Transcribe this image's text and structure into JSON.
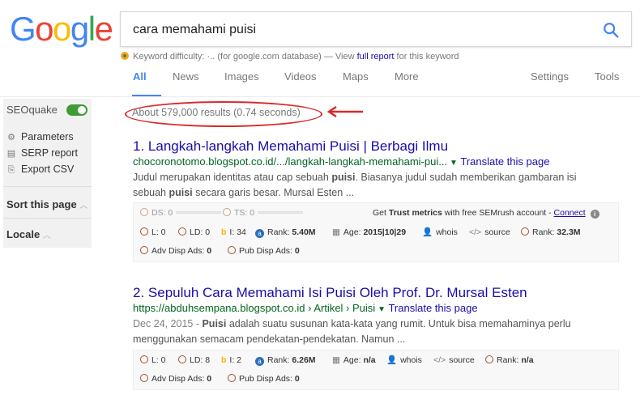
{
  "logo": {
    "letters": [
      "G",
      "o",
      "o",
      "g",
      "l",
      "e"
    ],
    "colors": [
      "#4285f4",
      "#ea4335",
      "#fbbc05",
      "#4285f4",
      "#34a853",
      "#ea4335"
    ]
  },
  "search": {
    "query": "cara memahami puisi",
    "icon": "search-icon"
  },
  "keyword_difficulty": {
    "label": "Keyword difficulty:",
    "value": "·..",
    "source": "(for google.com database) — View",
    "link": "full report",
    "suffix": "for this keyword"
  },
  "tabs": [
    {
      "label": "All",
      "active": true
    },
    {
      "label": "News"
    },
    {
      "label": "Images"
    },
    {
      "label": "Videos"
    },
    {
      "label": "Maps"
    },
    {
      "label": "More"
    },
    {
      "label": "Settings"
    },
    {
      "label": "Tools"
    }
  ],
  "sidebar": {
    "title": "SEOquake",
    "toggle_on": true,
    "items": [
      {
        "label": "Parameters",
        "icon": "gear-icon"
      },
      {
        "label": "SERP report",
        "icon": "report-icon"
      },
      {
        "label": "Export CSV",
        "icon": "export-icon"
      }
    ],
    "sort_label": "Sort this page",
    "locale_label": "Locale"
  },
  "stats": "About 579,000 results (0.74 seconds)",
  "results": [
    {
      "number": "1.",
      "title": "Langkah-langkah Memahami Puisi | Berbagi Ilmu",
      "url": "chocoronotomo.blogspot.co.id/.../langkah-langkah-memahami-pui...",
      "translate": "Translate this page",
      "snippet_line1": [
        {
          "t": "Judul merupakan identitas atau cap sebuah "
        },
        {
          "t": "puisi",
          "b": true
        },
        {
          "t": ". Biasanya judul sudah memberikan gambaran isi"
        }
      ],
      "snippet_line2": [
        {
          "t": "sebuah "
        },
        {
          "t": "puisi",
          "b": true
        },
        {
          "t": " secara garis besar. Mursal Esten ..."
        }
      ],
      "metrics": {
        "ds": "DS: 0",
        "ts": "TS: 0",
        "trust_pre": "Get",
        "trust_bold": "Trust metrics",
        "trust_post": "with free SEMrush account -",
        "connect": "Connect",
        "l": "L: 0",
        "ld": "LD: 0",
        "i": "I: 34",
        "rank_label": "Rank:",
        "rank": "5.40M",
        "age_label": "Age:",
        "age": "2015|10|29",
        "whois": "whois",
        "source": "source",
        "rank2_label": "Rank:",
        "rank2": "32.3M",
        "adv": "Adv Disp Ads:",
        "adv_val": "0",
        "pub": "Pub Disp Ads:",
        "pub_val": "0"
      }
    },
    {
      "number": "2.",
      "title": "Sepuluh Cara Memahami Isi Puisi Oleh Prof. Dr. Mursal Esten",
      "url": "https://abduhsempana.blogspot.co.id › Artikel › Puisi",
      "translate": "Translate this page",
      "date": "Dec 24, 2015 - ",
      "snippet_line1": [
        {
          "t": "Puisi",
          "b": true
        },
        {
          "t": " adalah suatu susunan kata-kata yang rumit. Untuk bisa memahaminya perlu"
        }
      ],
      "snippet_line2": [
        {
          "t": "menggunakan semacam pendekatan-pendekatan. Namun ..."
        }
      ],
      "metrics": {
        "l": "L: 0",
        "ld": "LD: 8",
        "i": "I: 2",
        "rank_label": "Rank:",
        "rank": "6.26M",
        "age_label": "Age:",
        "age": "n/a",
        "whois": "whois",
        "source": "source",
        "rank2_label": "Rank:",
        "rank2": "n/a",
        "adv": "Adv Disp Ads:",
        "adv_val": "0",
        "pub": "Pub Disp Ads:",
        "pub_val": "0"
      }
    }
  ]
}
